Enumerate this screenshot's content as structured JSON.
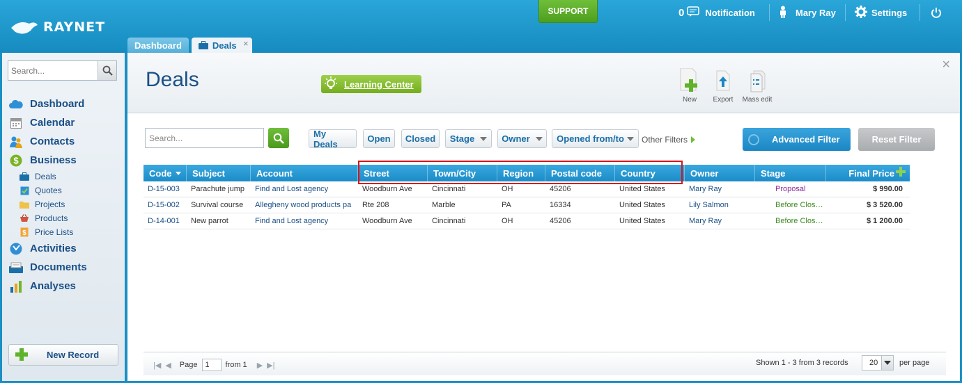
{
  "app": {
    "logo_text": "RAYNET"
  },
  "topbar": {
    "support_label": "SUPPORT",
    "notification_count": "0",
    "notification_label": "Notification",
    "user_name": "Mary Ray",
    "settings_label": "Settings"
  },
  "tabs": [
    {
      "label": "Dashboard"
    },
    {
      "label": "Deals",
      "close": "×"
    }
  ],
  "sidebar": {
    "search_placeholder": "Search...",
    "items": [
      {
        "label": "Dashboard"
      },
      {
        "label": "Calendar"
      },
      {
        "label": "Contacts"
      },
      {
        "label": "Business"
      }
    ],
    "sub_items": [
      {
        "label": "Deals"
      },
      {
        "label": "Quotes"
      },
      {
        "label": "Projects"
      },
      {
        "label": "Products"
      },
      {
        "label": "Price Lists"
      }
    ],
    "items_after": [
      {
        "label": "Activities"
      },
      {
        "label": "Documents"
      },
      {
        "label": "Analyses"
      }
    ],
    "new_record_label": "New Record"
  },
  "main": {
    "title": "Deals",
    "learning_center": "Learning Center",
    "toolbar": {
      "new": "New",
      "export": "Export",
      "mass_edit": "Mass edit"
    },
    "close": "×"
  },
  "filters": {
    "search_placeholder": "Search...",
    "my_deals": "My Deals",
    "open": "Open",
    "closed": "Closed",
    "stage": "Stage",
    "owner": "Owner",
    "opened_from_to": "Opened from/to",
    "other_filters": "Other Filters",
    "advanced_filter": "Advanced Filter",
    "reset_filter": "Reset Filter"
  },
  "table": {
    "columns": [
      "Code",
      "Subject",
      "Account",
      "Street",
      "Town/City",
      "Region",
      "Postal code",
      "Country",
      "Owner",
      "Stage",
      "Final Price"
    ],
    "rows": [
      [
        "D-15-003",
        "Parachute jump",
        "Find and Lost agency",
        "Woodburn Ave",
        "Cincinnati",
        "OH",
        "45206",
        "United States",
        "Mary Ray",
        "Proposal",
        "$ 990.00"
      ],
      [
        "D-15-002",
        "Survival course",
        "Allegheny wood products pa",
        "Rte 208",
        "Marble",
        "PA",
        "16334",
        "United States",
        "Lily Salmon",
        "Before Clos…",
        "$ 3 520.00"
      ],
      [
        "D-14-001",
        "New parrot",
        "Find and Lost agency",
        "Woodburn Ave",
        "Cincinnati",
        "OH",
        "45206",
        "United States",
        "Mary Ray",
        "Before Clos…",
        "$ 1 200.00"
      ]
    ],
    "stage_colors": {
      "Proposal": "#8a2a9b",
      "Before Clos…": "#3d8a1e"
    }
  },
  "footer": {
    "page_label": "Page",
    "page_value": "1",
    "from_label": "from 1",
    "shown": "Shown 1 - 3 from 3 records",
    "per_page_value": "20",
    "per_page_label": "per page"
  }
}
